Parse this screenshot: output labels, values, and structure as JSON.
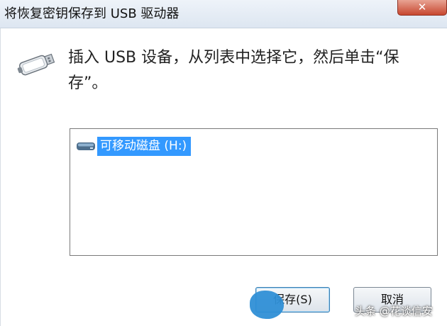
{
  "window": {
    "title": "将恢复密钥保存到 USB 驱动器",
    "close_glyph": "✕"
  },
  "main": {
    "instruction": "插入 USB 设备，从列表中选择它，然后单击“保存”。",
    "drives": [
      {
        "label": "可移动磁盘 (H:)",
        "selected": true
      }
    ]
  },
  "buttons": {
    "save_label": "保存(S)",
    "cancel_label": "取消"
  },
  "watermark": "头条 @花谈信安",
  "colors": {
    "selection": "#3399ff",
    "close_button": "#c7472f"
  },
  "icons": {
    "usb": "usb-drive-icon",
    "drive": "removable-disk-icon"
  }
}
